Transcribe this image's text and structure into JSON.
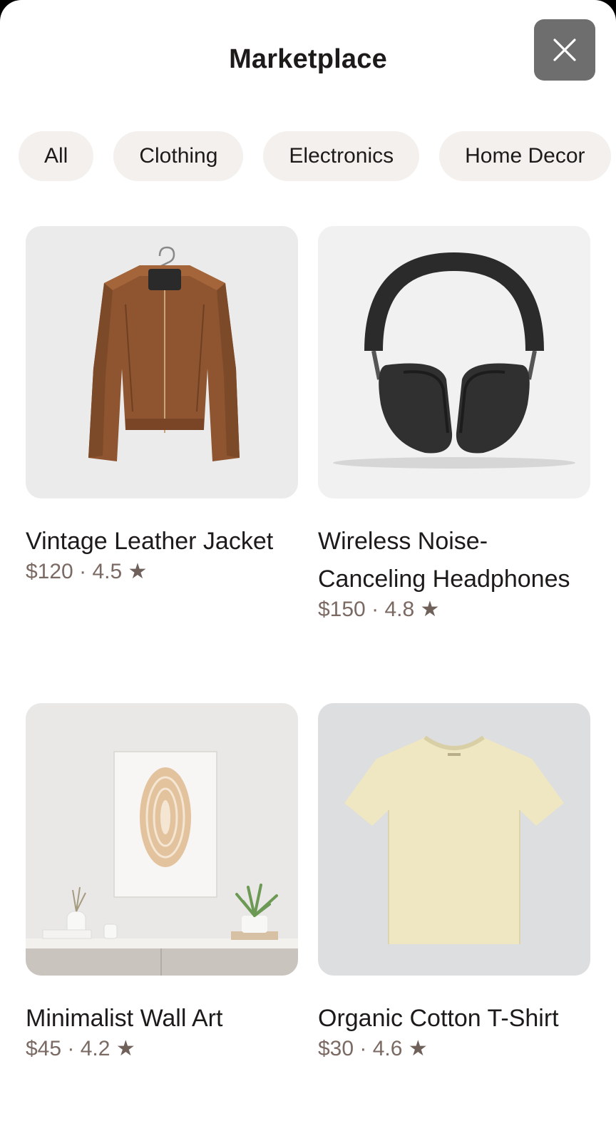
{
  "header": {
    "title": "Marketplace",
    "close_icon": "close-icon"
  },
  "categories": [
    {
      "label": "All"
    },
    {
      "label": "Clothing"
    },
    {
      "label": "Electronics"
    },
    {
      "label": "Home Decor"
    }
  ],
  "products": [
    {
      "name": "Vintage Leather Jacket",
      "price": "$120",
      "separator": "·",
      "rating": "4.5",
      "star": "★",
      "image": "leather-jacket-image"
    },
    {
      "name": "Wireless Noise-Canceling Headphones",
      "price": "$150",
      "separator": "·",
      "rating": "4.8",
      "star": "★",
      "image": "headphones-image"
    },
    {
      "name": "Minimalist Wall Art",
      "price": "$45",
      "separator": "·",
      "rating": "4.2",
      "star": "★",
      "image": "wall-art-image"
    },
    {
      "name": "Organic Cotton T-Shirt",
      "price": "$30",
      "separator": "·",
      "rating": "4.6",
      "star": "★",
      "image": "tshirt-image"
    }
  ],
  "colors": {
    "chip_bg": "#f3f0ee",
    "close_bg": "#6e6e6e",
    "meta_text": "#7b6a63"
  }
}
